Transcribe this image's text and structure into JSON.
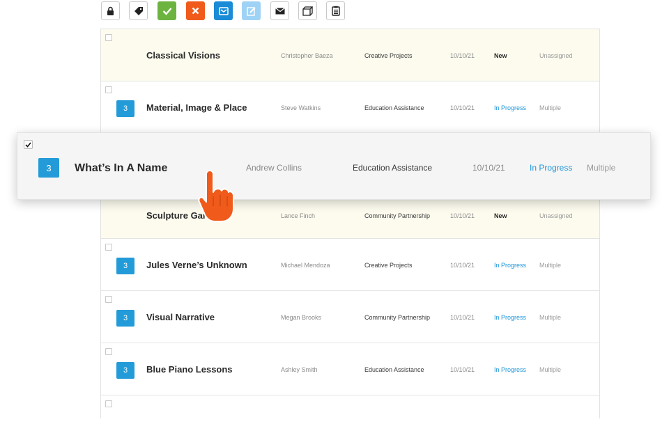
{
  "toolbar": {
    "buttons": [
      {
        "icon": "lock-icon",
        "color": "#ffffff"
      },
      {
        "icon": "tag-icon",
        "color": "#ffffff"
      },
      {
        "icon": "checkmark-icon",
        "color": "#6db33f"
      },
      {
        "icon": "close-icon",
        "color": "#f05a1a"
      },
      {
        "icon": "envelope-open-icon",
        "color": "#1a8bd6"
      },
      {
        "icon": "edit-icon",
        "color": "#9fd3f5"
      },
      {
        "icon": "envelope-icon",
        "color": "#ffffff"
      },
      {
        "icon": "box-icon",
        "color": "#ffffff"
      },
      {
        "icon": "clipboard-icon",
        "color": "#ffffff"
      }
    ]
  },
  "rows": [
    {
      "title": "Classical Visions",
      "author": "Christopher Baeza",
      "category": "Creative Projects",
      "date": "10/10/21",
      "status": "New",
      "assignee": "Unassigned"
    },
    {
      "badge": "3",
      "title": "Material, Image & Place",
      "author": "Steve Watkins",
      "category": "Education Assistance",
      "date": "10/10/21",
      "status": "In Progress",
      "assignee": "Multiple"
    },
    {
      "title": "Sculpture Gard",
      "author": "Lance Finch",
      "category": "Community Partnership",
      "date": "10/10/21",
      "status": "New",
      "assignee": "Unassigned"
    },
    {
      "badge": "3",
      "title": "Jules Verne’s Unknown",
      "author": "Michael Mendoza",
      "category": "Creative Projects",
      "date": "10/10/21",
      "status": "In Progress",
      "assignee": "Multiple"
    },
    {
      "badge": "3",
      "title": "Visual Narrative",
      "author": "Megan Brooks",
      "category": "Community Partnership",
      "date": "10/10/21",
      "status": "In Progress",
      "assignee": "Multiple"
    },
    {
      "badge": "3",
      "title": "Blue Piano Lessons",
      "author": "Ashley Smith",
      "category": "Education Assistance",
      "date": "10/10/21",
      "status": "In Progress",
      "assignee": "Multiple"
    }
  ],
  "dragged_row": {
    "checked": true,
    "badge": "3",
    "title": "What’s In A Name",
    "author": "Andrew Collins",
    "category": "Education Assistance",
    "date": "10/10/21",
    "status": "In Progress",
    "assignee": "Multiple"
  },
  "cursor": {
    "icon": "grab-hand-cursor-icon",
    "color": "#f05a1a"
  },
  "colors": {
    "accent": "#239bd8",
    "new_row_bg": "#fcfbee",
    "in_progress": "#1f96d8"
  }
}
